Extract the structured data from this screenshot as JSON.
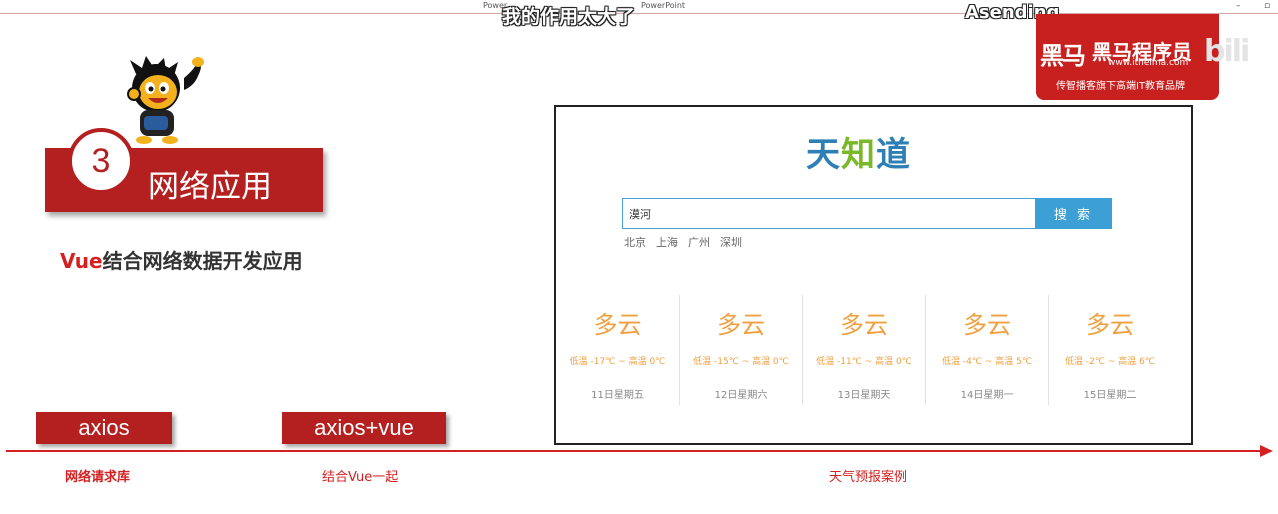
{
  "window": {
    "title": "Power",
    "app": "PowerPoint",
    "controls": [
      "–",
      "▫"
    ]
  },
  "caption": {
    "subtitle": "我的作用太大了",
    "username": "Asending"
  },
  "brand": {
    "logo": "黑马",
    "name": "黑马程序员",
    "url": "www.itheima.com",
    "slogan": "传智播客旗下高端IT教育品牌",
    "watermark": "bili"
  },
  "section": {
    "number": "3",
    "title": "网络应用",
    "subtitle_accent": "Vue",
    "subtitle_rest": "结合网络数据开发应用"
  },
  "weather_app": {
    "logo_parts": [
      "天",
      "知",
      "道"
    ],
    "search_value": "漠河",
    "search_button": "搜 索",
    "hot_cities": [
      "北京",
      "上海",
      "广州",
      "深圳"
    ],
    "forecast": [
      {
        "type": "多云",
        "temp": "低温 -17℃ ~ 高温 0℃",
        "date": "11日星期五"
      },
      {
        "type": "多云",
        "temp": "低温 -15℃ ~ 高温 0℃",
        "date": "12日星期六"
      },
      {
        "type": "多云",
        "temp": "低温 -11℃ ~ 高温 0℃",
        "date": "13日星期天"
      },
      {
        "type": "多云",
        "temp": "低温 -4℃ ~ 高温 5℃",
        "date": "14日星期一"
      },
      {
        "type": "多云",
        "temp": "低温 -2℃ ~ 高温 6℃",
        "date": "15日星期二"
      }
    ],
    "accent_color": "#3c9fd6",
    "weather_color": "#f0a040"
  },
  "timeline": {
    "tags": [
      "axios",
      "axios+vue"
    ],
    "labels": [
      "网络请求库",
      "结合Vue一起",
      "天气预报案例"
    ],
    "color": "#d42020"
  }
}
